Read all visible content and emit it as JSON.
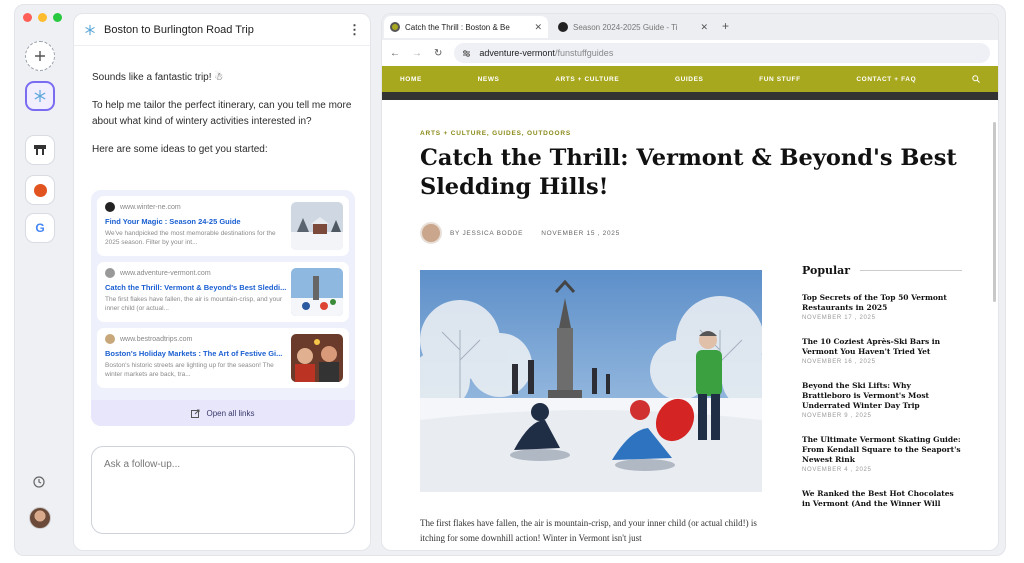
{
  "traffic_lights": [
    "#ff5f57",
    "#febc2e",
    "#28c840"
  ],
  "chat": {
    "title": "Boston to Burlington Road Trip",
    "menu_icon": "kebab-icon",
    "messages": [
      "Sounds like a fantastic trip! ☃",
      "To help me tailor the perfect itinerary, can you tell me more about what kind of wintery activities interested in?",
      "Here are some ideas to get you started:"
    ],
    "results": [
      {
        "site": "www.winter-ne.com",
        "title": "Find Your Magic : Season 24-25 Guide",
        "desc": "We've handpicked the most memorable destinations for the 2025 season. Filter by your int..."
      },
      {
        "site": "www.adventure-vermont.com",
        "title": "Catch the Thrill: Vermont & Beyond's Best Sleddi...",
        "desc": "The first flakes have fallen, the air is mountain-crisp, and your inner child (or actual..."
      },
      {
        "site": "www.bestroadtrips.com",
        "title": "Boston's Holiday Markets : The Art of Festive Gi...",
        "desc": "Boston's historic streets are lighting up for the season! The winter markets are back, tra..."
      }
    ],
    "open_all_label": "Open all links",
    "followup_placeholder": "Ask a follow-up..."
  },
  "browser": {
    "tabs": [
      {
        "label": "Catch the Thrill : Boston & Be",
        "active": true
      },
      {
        "label": "Season 2024-2025 Guide - Ti",
        "active": false
      }
    ],
    "url_domain": "adventure-vermont",
    "url_path": "/funstuffguides"
  },
  "site": {
    "nav": [
      "HOME",
      "NEWS",
      "ARTS + CULTURE",
      "GUIDES",
      "FUN STUFF",
      "CONTACT + FAQ"
    ],
    "nav_color": "#a8a81f",
    "categories": "ARTS + CULTURE, GUIDES, OUTDOORS",
    "headline": "Catch the Thrill: Vermont & Beyond's Best Sledding Hills!",
    "byline_author": "BY JESSICA BODDE",
    "byline_date": "NOVEMBER 15 , 2025",
    "body": "The first flakes have fallen, the air is mountain-crisp, and your inner child (or actual child!) is itching for some downhill action! Winter in Vermont isn't just",
    "popular_title": "Popular",
    "popular": [
      {
        "title": "Top Secrets of the Top 50 Vermont Restaurants in 2025",
        "date": "NOVEMBER 17 , 2025"
      },
      {
        "title": "The 10 Coziest Après-Ski Bars in Vermont You Haven't Tried Yet",
        "date": "NOVEMBER 16 , 2025"
      },
      {
        "title": "Beyond the Ski Lifts: Why Brattleboro is Vermont's Most Underrated Winter Day Trip",
        "date": "NOVEMBER 9 , 2025"
      },
      {
        "title": "The Ultimate Vermont Skating Guide: From Kendall Square to the Seaport's Newest Rink",
        "date": "NOVEMBER 4 , 2025"
      },
      {
        "title": "We Ranked the Best Hot Chocolates in Vermont (And the Winner Will",
        "date": ""
      }
    ]
  }
}
